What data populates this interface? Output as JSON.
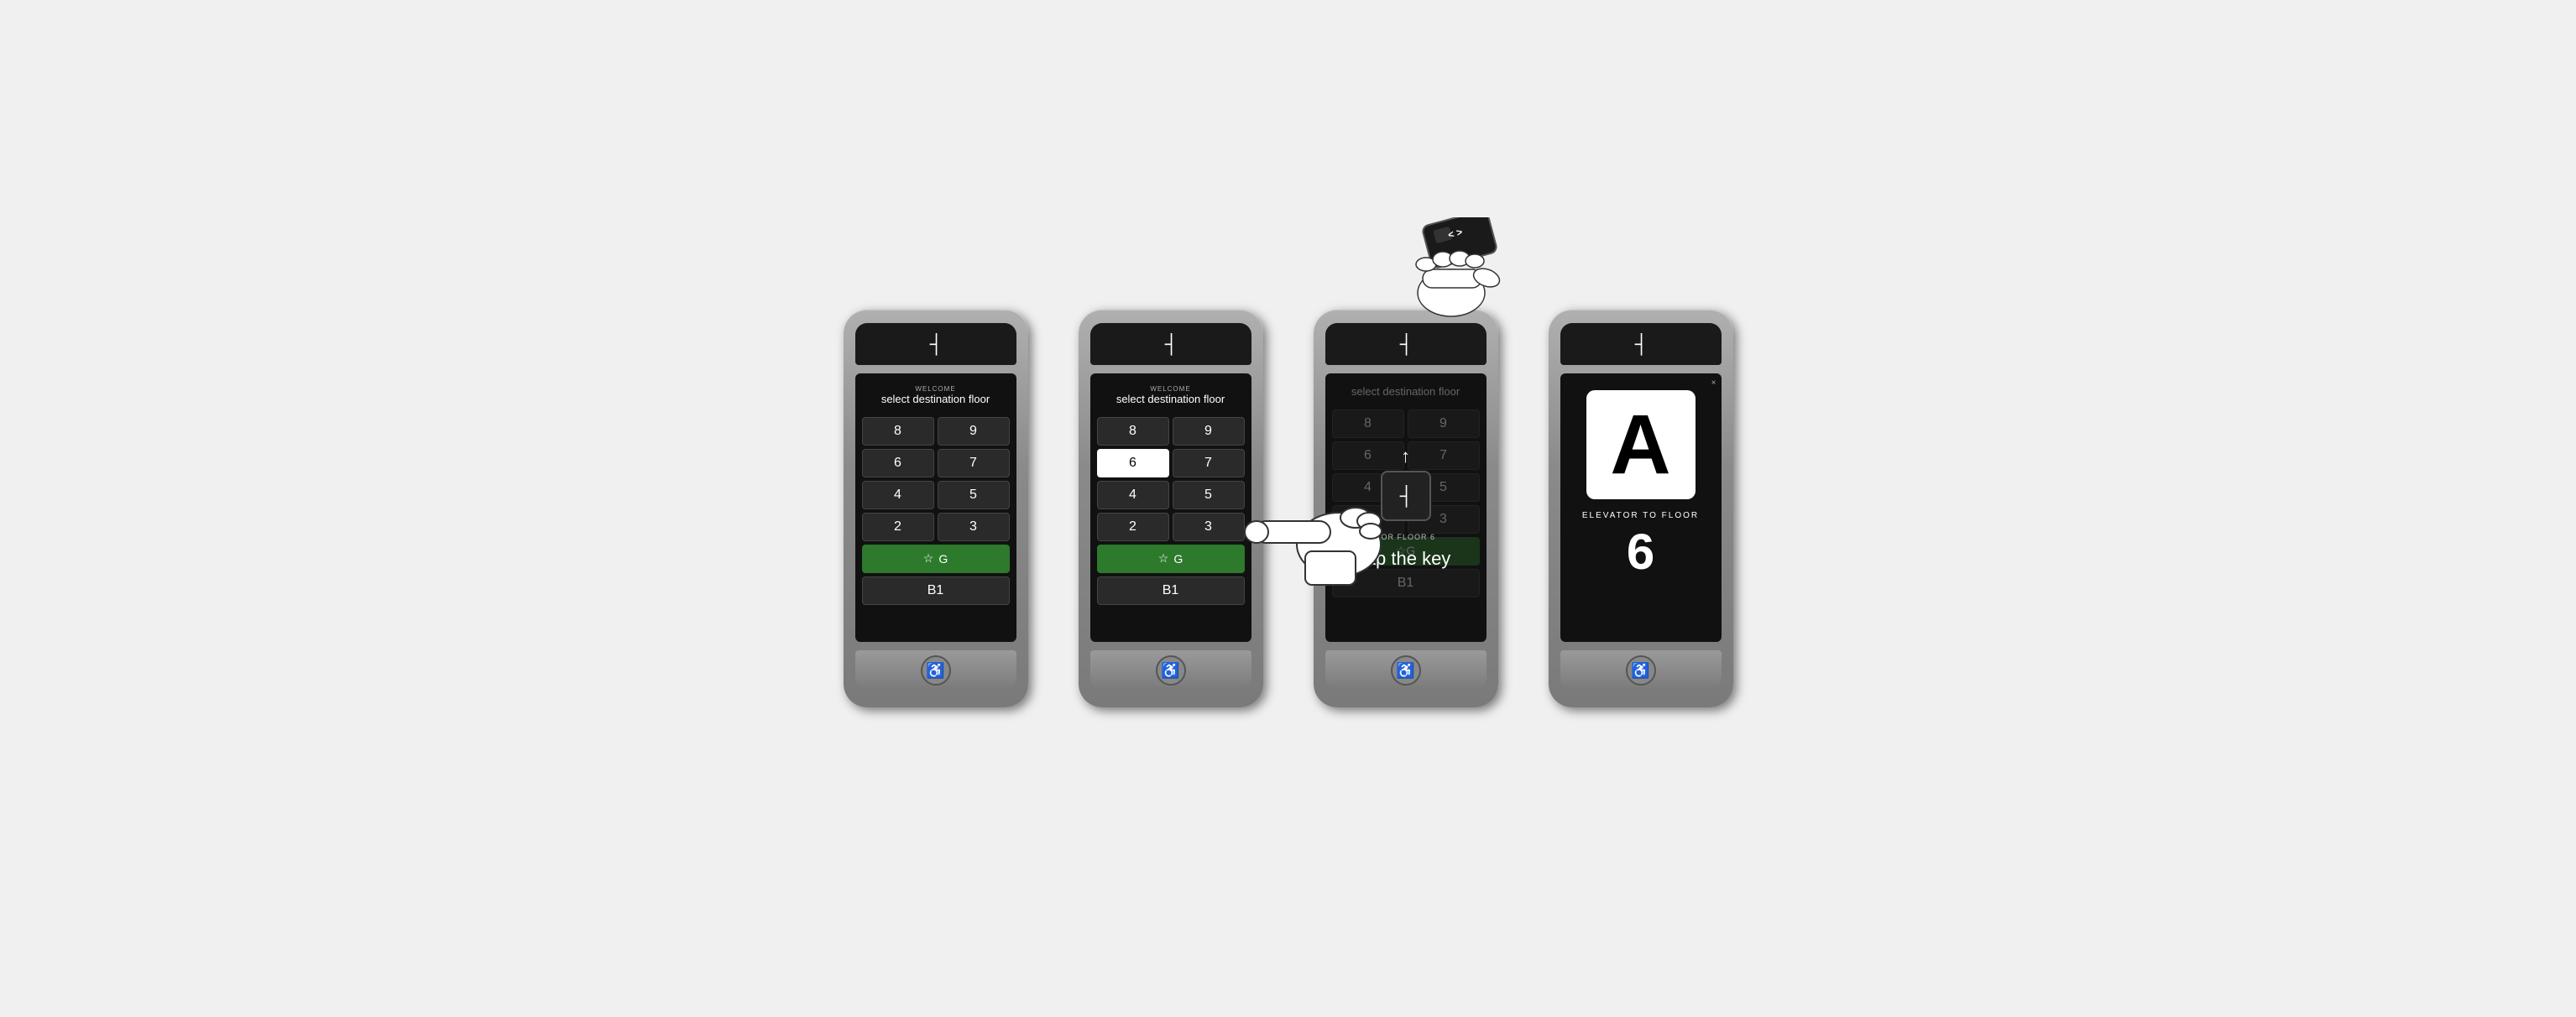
{
  "devices": [
    {
      "id": "device-1",
      "state": "idle",
      "logo": "┤",
      "header": {
        "welcome": "WELCOME",
        "title": "select destination floor"
      },
      "floors": [
        {
          "label": "8",
          "col": 1
        },
        {
          "label": "9",
          "col": 2
        },
        {
          "label": "6",
          "col": 1
        },
        {
          "label": "7",
          "col": 2
        },
        {
          "label": "4",
          "col": 1
        },
        {
          "label": "5",
          "col": 2
        },
        {
          "label": "2",
          "col": 1
        },
        {
          "label": "3",
          "col": 2
        }
      ],
      "special_floors": [
        {
          "label": "☆G",
          "type": "green"
        },
        {
          "label": "B1",
          "type": "normal"
        }
      ],
      "accessibility_icon": "♿"
    },
    {
      "id": "device-2",
      "state": "selected",
      "logo": "┤",
      "header": {
        "welcome": "WELCOME",
        "title": "select destination floor"
      },
      "floors": [
        {
          "label": "8",
          "col": 1
        },
        {
          "label": "9",
          "col": 2
        },
        {
          "label": "6",
          "col": 1,
          "active": true
        },
        {
          "label": "7",
          "col": 2
        },
        {
          "label": "4",
          "col": 1
        },
        {
          "label": "5",
          "col": 2
        },
        {
          "label": "2",
          "col": 1
        },
        {
          "label": "3",
          "col": 2
        }
      ],
      "special_floors": [
        {
          "label": "☆G",
          "type": "green"
        },
        {
          "label": "B1",
          "type": "normal"
        }
      ],
      "accessibility_icon": "♿"
    },
    {
      "id": "device-3",
      "state": "tap-key",
      "logo": "┤",
      "header": {
        "welcome": "",
        "title": "select destination floor"
      },
      "floors": [
        {
          "label": "8",
          "col": 1
        },
        {
          "label": "9",
          "col": 2
        },
        {
          "label": "6",
          "col": 1
        },
        {
          "label": "7",
          "col": 2
        },
        {
          "label": "4",
          "col": 1
        },
        {
          "label": "5",
          "col": 2
        },
        {
          "label": "2",
          "col": 1
        },
        {
          "label": "3",
          "col": 2
        }
      ],
      "special_floors": [
        {
          "label": "☆G",
          "type": "green"
        },
        {
          "label": "B1",
          "type": "normal"
        }
      ],
      "tap_overlay": {
        "for_floor_label": "FOR FLOOR 6",
        "instruction": "tap the key"
      },
      "accessibility_icon": "♿"
    },
    {
      "id": "device-4",
      "state": "assigned",
      "logo": "┤",
      "elevator_assignment": {
        "close_label": "×",
        "letter": "A",
        "to_floor_label": "ELEVATOR TO FLOOR",
        "floor_number": "6"
      },
      "accessibility_icon": "♿"
    }
  ],
  "hand_gesture": {
    "description": "pointing hand",
    "visible": true
  },
  "card_tap": {
    "description": "NFC card being tapped",
    "visible": true
  }
}
